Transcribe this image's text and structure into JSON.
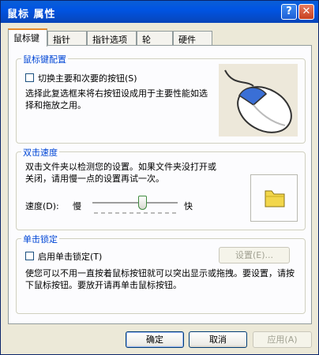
{
  "window": {
    "title": "鼠标 属性",
    "help_label": "?",
    "close_label": "✕"
  },
  "tabs": [
    {
      "label": "鼠标键"
    },
    {
      "label": "指针"
    },
    {
      "label": "指针选项"
    },
    {
      "label": "轮"
    },
    {
      "label": "硬件"
    }
  ],
  "button_config": {
    "title": "鼠标键配置",
    "swap_label": "切换主要和次要的按钮(S)",
    "swap_checked": false,
    "description": "选择此复选框来将右按钮设成用于主要性能如选择和拖放之用。"
  },
  "double_click": {
    "title": "双击速度",
    "description": "双击文件夹以检测您的设置。如果文件夹没打开或关闭，请用慢一点的设置再试一次。",
    "speed_label": "速度(D):",
    "slow_label": "慢",
    "fast_label": "快",
    "slider_level": 0.6
  },
  "click_lock": {
    "title": "单击锁定",
    "enable_label": "启用单击锁定(T)",
    "enabled": false,
    "settings_label": "设置(E)...",
    "description": "使您可以不用一直按着鼠标按钮就可以突出显示或拖拽。要设置，请按下鼠标按钮。要放开请再单击鼠标按钮。"
  },
  "footer": {
    "ok_label": "确定",
    "cancel_label": "取消",
    "apply_label": "应用(A)"
  },
  "colors": {
    "title_bar": "#0054e3",
    "group_title": "#0046d5",
    "active_tab_accent": "#e68b2c",
    "mouse_primary_button": "#3a6fd6",
    "folder": "#f2d64b"
  }
}
